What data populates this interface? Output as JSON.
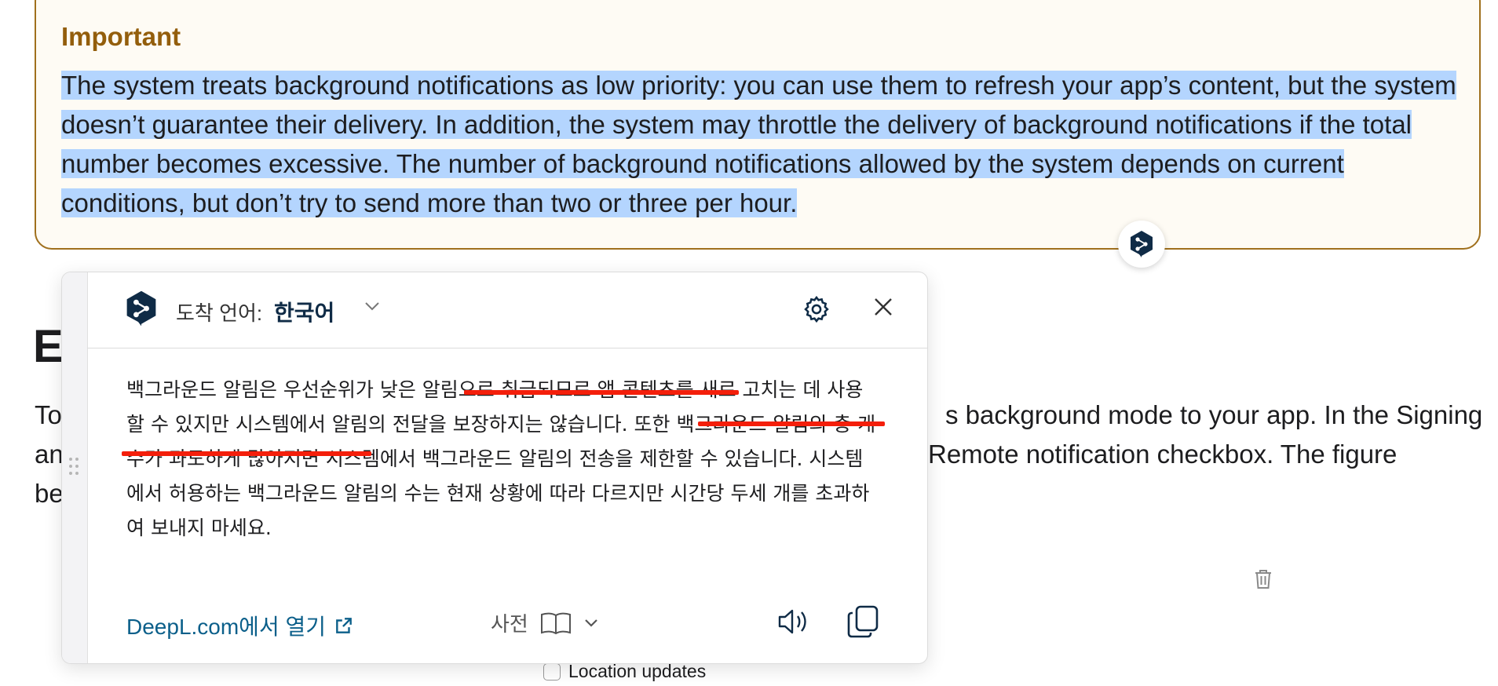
{
  "aside": {
    "title": "Important",
    "body": "The system treats background notifications as low priority: you can use them to refresh your app’s content, but the system doesn’t guarantee their delivery. In addition, the system may throttle the delivery of background notifications if the total number becomes excessive. The number of background notifications allowed by the system depends on current conditions, but don’t try to send more than two or three per hour."
  },
  "background": {
    "heading_letter": "E",
    "line1_left": "To",
    "line1_right": "s background mode to your app. In the Signing",
    "line2_left": "an",
    "line2_right": "Remote notification checkbox. The figure",
    "line3_left": "be",
    "checkbox_label": "Location updates"
  },
  "popup": {
    "target_language_label": "도착 언어:",
    "target_language_value": "한국어",
    "translation": "백그라운드 알림은 우선순위가 낮은 알림으로 취급되므로 앱 콘텐츠를 새로 고치는 데 사용할 수 있지만 시스템에서 알림의 전달을 보장하지는 않습니다. 또한 백그라운드 알림의 총 개수가 과도하게 많아지면 시스템에서 백그라운드 알림의 전송을 제한할 수 있습니다. 시스템에서 허용하는 백그라운드 알림의 수는 현재 상황에 따라 다르지만 시간당 두세 개를 초과하여 보내지 마세요.",
    "open_link": "DeepL.com에서 열기",
    "dictionary_label": "사전"
  },
  "colors": {
    "accent_title": "#935e0c",
    "selection": "#b4d5fe",
    "underline": "#f41f0b",
    "deepl_navy": "#0f2b46",
    "link": "#0b5f8a"
  }
}
